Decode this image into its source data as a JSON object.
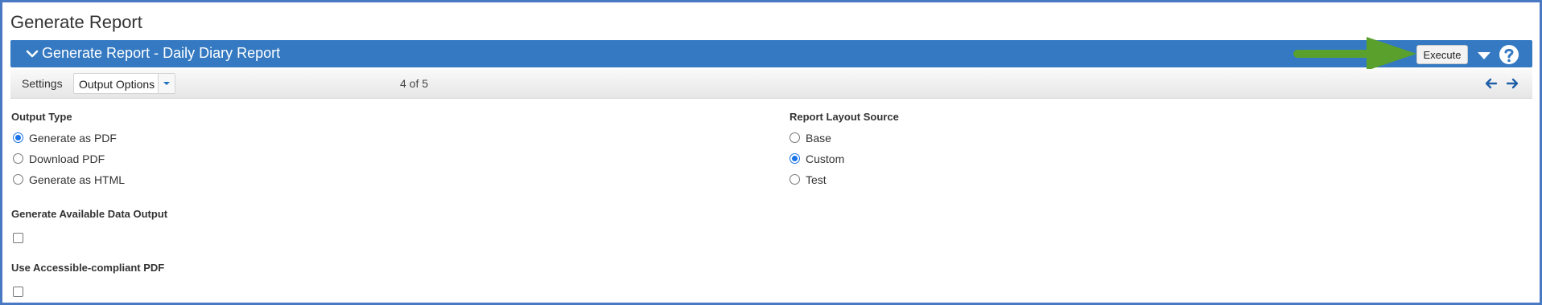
{
  "page": {
    "title": "Generate Report"
  },
  "panel": {
    "title": "Generate Report - Daily Diary Report",
    "execute_label": "Execute",
    "header_color": "#3479c1",
    "arrow_color": "#5aa02c"
  },
  "toolbar": {
    "settings_label": "Settings",
    "step_select": "Output Options",
    "pager": "4 of 5"
  },
  "output_type": {
    "label": "Output Type",
    "options": [
      {
        "label": "Generate as PDF",
        "checked": true
      },
      {
        "label": "Download PDF",
        "checked": false
      },
      {
        "label": "Generate as HTML",
        "checked": false
      }
    ]
  },
  "report_layout_source": {
    "label": "Report Layout Source",
    "options": [
      {
        "label": "Base",
        "checked": false
      },
      {
        "label": "Custom",
        "checked": true
      },
      {
        "label": "Test",
        "checked": false
      }
    ]
  },
  "available_data_output": {
    "label": "Generate Available Data Output",
    "checked": false
  },
  "accessible_pdf": {
    "label": "Use Accessible-compliant PDF",
    "checked": false
  },
  "icons": {
    "collapse": "chevron-down-icon",
    "more": "caret-down-icon",
    "help": "help-icon",
    "prev": "arrow-left-icon",
    "next": "arrow-right-icon"
  }
}
